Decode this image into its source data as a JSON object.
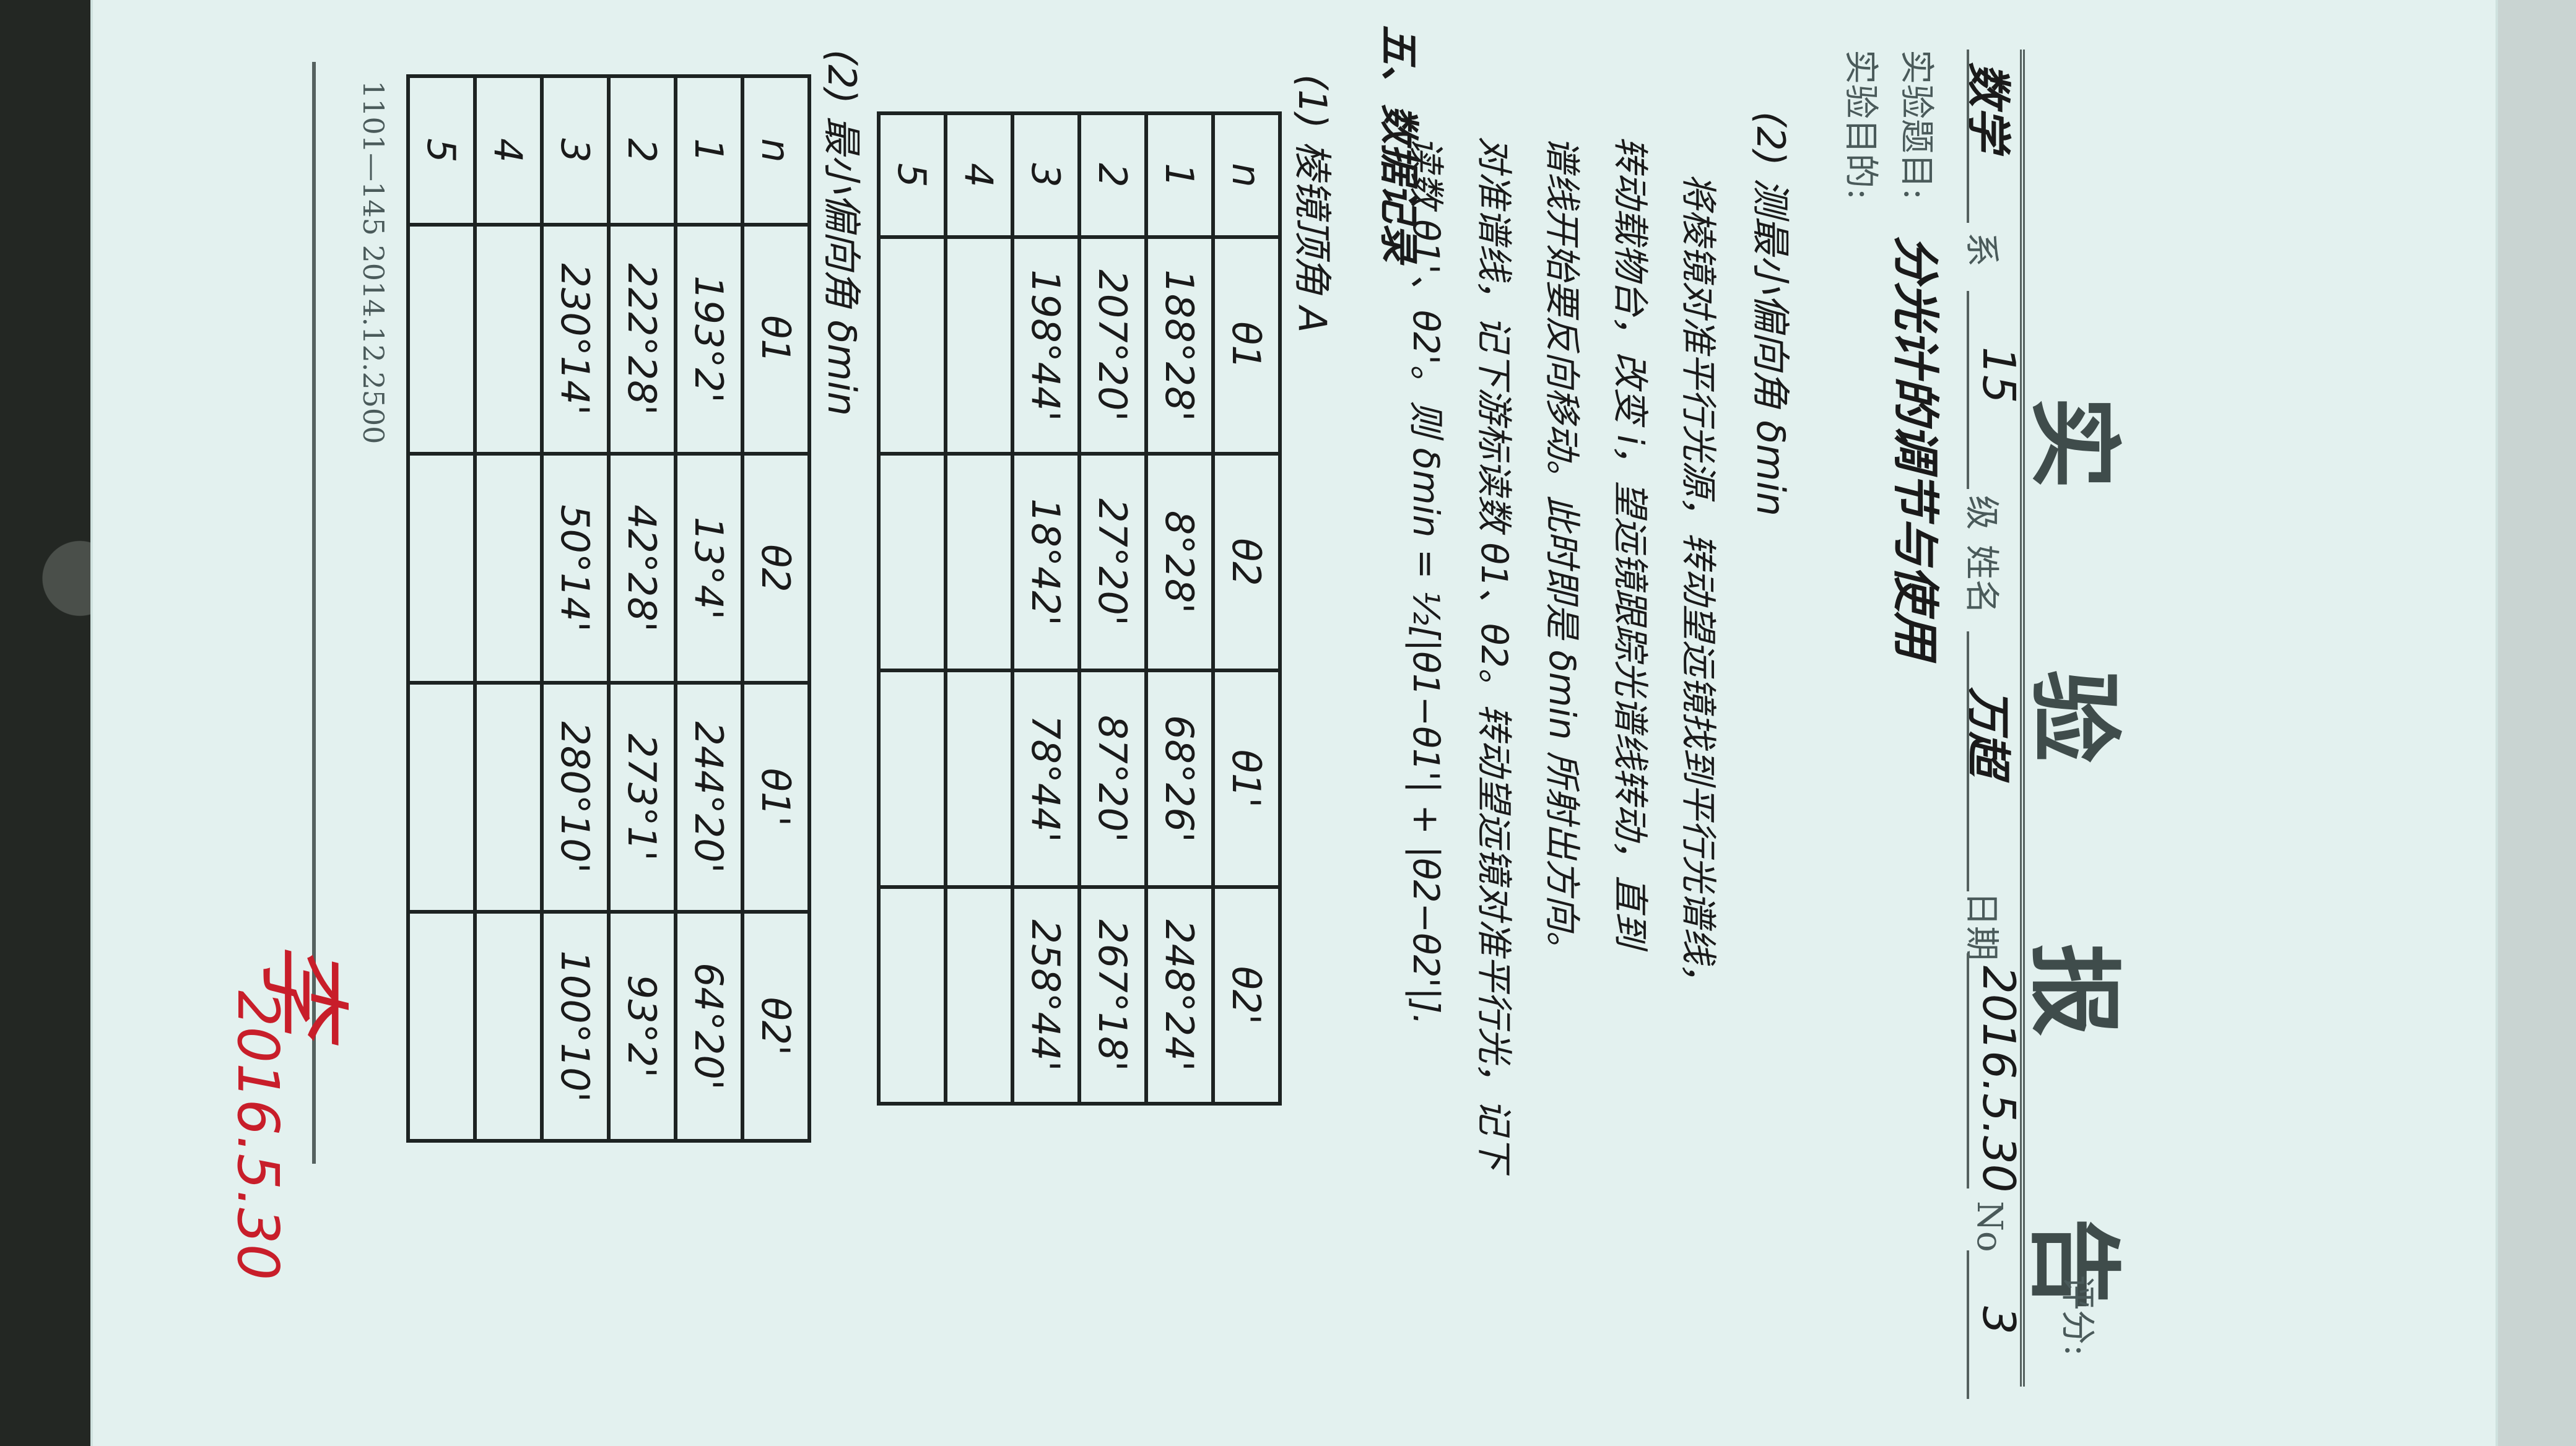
{
  "report": {
    "title": "实 验 报 告",
    "score_label": "评分:",
    "department_value": "数学",
    "department_label": "系",
    "grade_value": "15",
    "grade_label": "级",
    "name_label": "姓名",
    "name_value": "万超",
    "date_label": "日期",
    "date_value": "2016.5.30",
    "no_label": "No",
    "no_value": "3",
    "topic_label": "实验题目:",
    "topic_value": "分光计的调节与使用",
    "purpose_label": "实验目的:"
  },
  "procedure": {
    "heading": "(2) 测最小偏向角 δmin",
    "lines": [
      "将棱镜对准平行光源，转动望远镜找到平行光谱线，",
      "转动载物台，改变 i，望远镜跟踪光谱线转动，直到",
      "谱线开始要反向移动。此时即是 δmin 所射出方向。",
      "对准谱线，记下游标读数 θ1、θ2。转动望远镜对准平行光，记下",
      "读数 θ1'、θ2'。则 δmin = ½[|θ1−θ1'| + |θ2−θ2'|]."
    ]
  },
  "data_section": {
    "heading": "五、数据记录",
    "sub1": "(1) 棱镜顶角 A",
    "sub2": "(2) 最小偏向角 δmin"
  },
  "table1": {
    "headers": [
      "n",
      "θ1",
      "θ2",
      "θ1'",
      "θ2'"
    ],
    "rows": [
      [
        "1",
        "188°28'",
        "8°28'",
        "68°26'",
        "248°24'"
      ],
      [
        "2",
        "207°20'",
        "27°20'",
        "87°20'",
        "267°18'"
      ],
      [
        "3",
        "198°44'",
        "18°42'",
        "78°44'",
        "258°44'"
      ],
      [
        "4",
        "",
        "",
        "",
        ""
      ],
      [
        "5",
        "",
        "",
        "",
        ""
      ]
    ]
  },
  "table2": {
    "headers": [
      "n",
      "θ1",
      "θ2",
      "θ1'",
      "θ2'"
    ],
    "rows": [
      [
        "1",
        "193°2'",
        "13°4'",
        "244°20'",
        "64°20'"
      ],
      [
        "2",
        "222°28'",
        "42°28'",
        "273°1'",
        "93°2'"
      ],
      [
        "3",
        "230°14'",
        "50°14'",
        "280°10'",
        "100°10'"
      ],
      [
        "4",
        "",
        "",
        "",
        ""
      ],
      [
        "5",
        "",
        "",
        "",
        ""
      ]
    ]
  },
  "footer": {
    "print_code": "1101—145  2014.12.2500"
  },
  "teacher_mark": {
    "signature": "李",
    "date": "2016.5.30"
  },
  "colors": {
    "paper": "#e3f1ef",
    "ink": "#1a1a1a",
    "print": "#4a5a5a",
    "red_ink": "#c81e2a"
  }
}
